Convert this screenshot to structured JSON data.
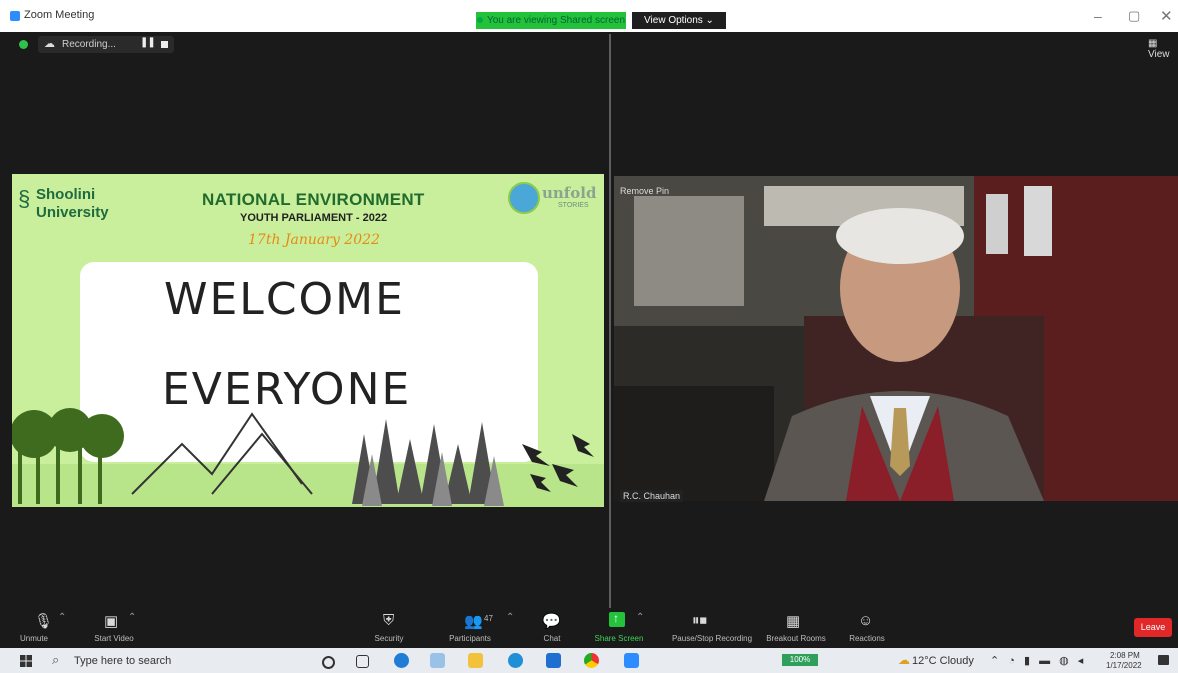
{
  "window": {
    "title": "Zoom Meeting",
    "banner": "You are viewing Shared screen",
    "view_options": "View Options ⌄",
    "minimize": "–",
    "maximize": "▢",
    "close": "✕",
    "view_right": "▦ View"
  },
  "recording": {
    "label": "Recording...",
    "pause": "❚❚",
    "cloud_icon": "☁"
  },
  "slide": {
    "university_line1": "Shoolini",
    "university_line2": "University",
    "title": "NATIONAL ENVIRONMENT",
    "subtitle": "YOUTH PARLIAMENT - 2022",
    "date": "17th January 2022",
    "logo_text": "unfold",
    "logo_sub": "STORIES",
    "welcome_line1": "WELCOME",
    "welcome_line2": "EVERYONE"
  },
  "video": {
    "remove_pin": "Remove Pin",
    "name_tag": "R.C. Chauhan"
  },
  "toolbar": {
    "items": [
      {
        "label": "Unmute",
        "icon": "mic-muted-icon"
      },
      {
        "label": "Start Video",
        "icon": "video-off-icon"
      },
      {
        "label": "Security",
        "icon": "shield-icon"
      },
      {
        "label": "Participants",
        "icon": "participants-icon"
      },
      {
        "label": "Chat",
        "icon": "chat-icon"
      },
      {
        "label": "Share Screen",
        "icon": "share-screen-icon"
      },
      {
        "label": "Pause/Stop Recording",
        "icon": "recording-controls-icon"
      },
      {
        "label": "Breakout Rooms",
        "icon": "breakout-rooms-icon"
      },
      {
        "label": "Reactions",
        "icon": "reactions-icon"
      }
    ],
    "participants_count": "47",
    "leave": "Leave"
  },
  "taskbar": {
    "search_placeholder": "Type here to search",
    "battery": "100%",
    "weather": "12°C  Cloudy",
    "sys_icons": "⌃ ◔ ▮ ▬ ◍ ◂",
    "time": "2:08 PM",
    "date": "1/17/2022"
  },
  "colors": {
    "accent_green": "#23c23a",
    "leave_red": "#e02828",
    "slide_bg": "#c9ef9c",
    "date_orange": "#e88a13"
  }
}
